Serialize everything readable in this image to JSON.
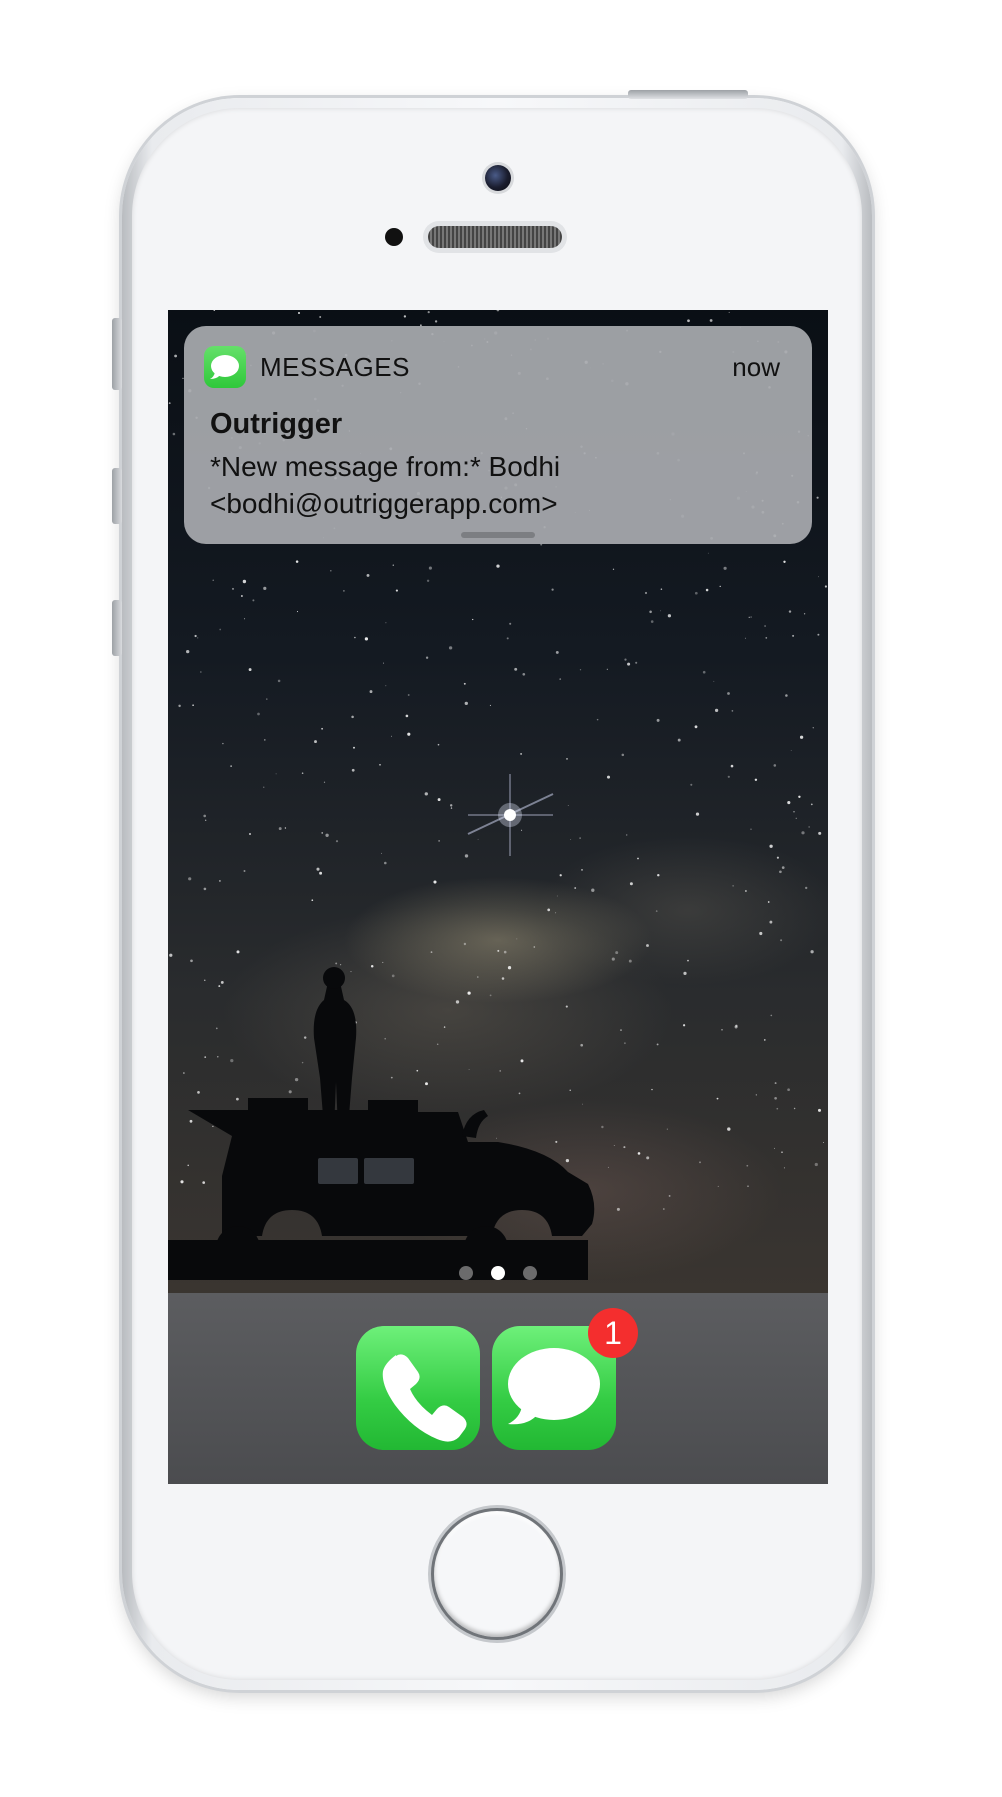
{
  "notification": {
    "app_name": "MESSAGES",
    "time": "now",
    "title": "Outrigger",
    "body_line1": "*New message from:* Bodhi",
    "body_line2": "<bodhi@outriggerapp.com>",
    "app_icon": "messages-icon"
  },
  "home_screen": {
    "page_count": 3,
    "current_page": 2
  },
  "dock": {
    "apps": [
      {
        "name": "Phone",
        "icon": "phone-icon"
      },
      {
        "name": "Messages",
        "icon": "messages-icon",
        "badge": "1"
      }
    ]
  },
  "colors": {
    "app_green": "#34cc44",
    "badge_red": "#f42e2e",
    "notification_bg": "#a8aaae",
    "dock_bg": "#555659"
  }
}
